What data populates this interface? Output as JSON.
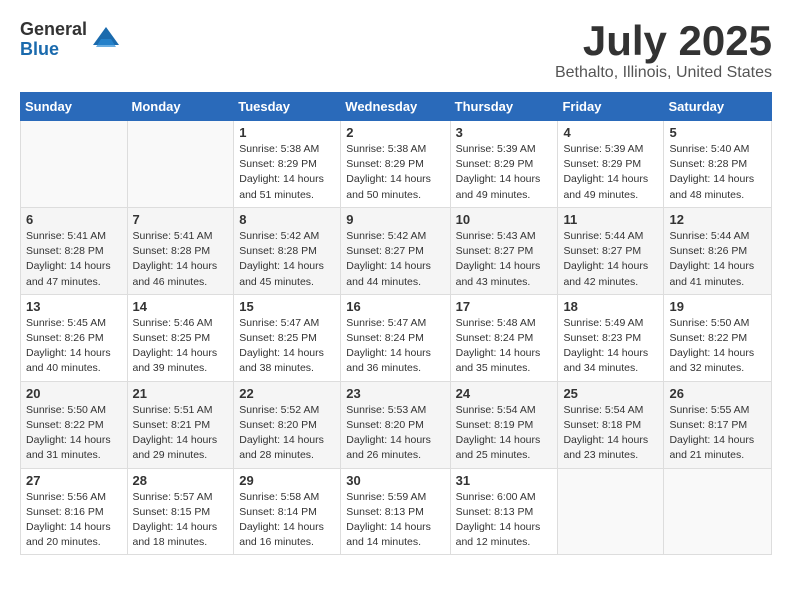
{
  "header": {
    "logo_general": "General",
    "logo_blue": "Blue",
    "month_title": "July 2025",
    "location": "Bethalto, Illinois, United States"
  },
  "weekdays": [
    "Sunday",
    "Monday",
    "Tuesday",
    "Wednesday",
    "Thursday",
    "Friday",
    "Saturday"
  ],
  "weeks": [
    [
      {
        "day": "",
        "info": ""
      },
      {
        "day": "",
        "info": ""
      },
      {
        "day": "1",
        "info": "Sunrise: 5:38 AM\nSunset: 8:29 PM\nDaylight: 14 hours and 51 minutes."
      },
      {
        "day": "2",
        "info": "Sunrise: 5:38 AM\nSunset: 8:29 PM\nDaylight: 14 hours and 50 minutes."
      },
      {
        "day": "3",
        "info": "Sunrise: 5:39 AM\nSunset: 8:29 PM\nDaylight: 14 hours and 49 minutes."
      },
      {
        "day": "4",
        "info": "Sunrise: 5:39 AM\nSunset: 8:29 PM\nDaylight: 14 hours and 49 minutes."
      },
      {
        "day": "5",
        "info": "Sunrise: 5:40 AM\nSunset: 8:28 PM\nDaylight: 14 hours and 48 minutes."
      }
    ],
    [
      {
        "day": "6",
        "info": "Sunrise: 5:41 AM\nSunset: 8:28 PM\nDaylight: 14 hours and 47 minutes."
      },
      {
        "day": "7",
        "info": "Sunrise: 5:41 AM\nSunset: 8:28 PM\nDaylight: 14 hours and 46 minutes."
      },
      {
        "day": "8",
        "info": "Sunrise: 5:42 AM\nSunset: 8:28 PM\nDaylight: 14 hours and 45 minutes."
      },
      {
        "day": "9",
        "info": "Sunrise: 5:42 AM\nSunset: 8:27 PM\nDaylight: 14 hours and 44 minutes."
      },
      {
        "day": "10",
        "info": "Sunrise: 5:43 AM\nSunset: 8:27 PM\nDaylight: 14 hours and 43 minutes."
      },
      {
        "day": "11",
        "info": "Sunrise: 5:44 AM\nSunset: 8:27 PM\nDaylight: 14 hours and 42 minutes."
      },
      {
        "day": "12",
        "info": "Sunrise: 5:44 AM\nSunset: 8:26 PM\nDaylight: 14 hours and 41 minutes."
      }
    ],
    [
      {
        "day": "13",
        "info": "Sunrise: 5:45 AM\nSunset: 8:26 PM\nDaylight: 14 hours and 40 minutes."
      },
      {
        "day": "14",
        "info": "Sunrise: 5:46 AM\nSunset: 8:25 PM\nDaylight: 14 hours and 39 minutes."
      },
      {
        "day": "15",
        "info": "Sunrise: 5:47 AM\nSunset: 8:25 PM\nDaylight: 14 hours and 38 minutes."
      },
      {
        "day": "16",
        "info": "Sunrise: 5:47 AM\nSunset: 8:24 PM\nDaylight: 14 hours and 36 minutes."
      },
      {
        "day": "17",
        "info": "Sunrise: 5:48 AM\nSunset: 8:24 PM\nDaylight: 14 hours and 35 minutes."
      },
      {
        "day": "18",
        "info": "Sunrise: 5:49 AM\nSunset: 8:23 PM\nDaylight: 14 hours and 34 minutes."
      },
      {
        "day": "19",
        "info": "Sunrise: 5:50 AM\nSunset: 8:22 PM\nDaylight: 14 hours and 32 minutes."
      }
    ],
    [
      {
        "day": "20",
        "info": "Sunrise: 5:50 AM\nSunset: 8:22 PM\nDaylight: 14 hours and 31 minutes."
      },
      {
        "day": "21",
        "info": "Sunrise: 5:51 AM\nSunset: 8:21 PM\nDaylight: 14 hours and 29 minutes."
      },
      {
        "day": "22",
        "info": "Sunrise: 5:52 AM\nSunset: 8:20 PM\nDaylight: 14 hours and 28 minutes."
      },
      {
        "day": "23",
        "info": "Sunrise: 5:53 AM\nSunset: 8:20 PM\nDaylight: 14 hours and 26 minutes."
      },
      {
        "day": "24",
        "info": "Sunrise: 5:54 AM\nSunset: 8:19 PM\nDaylight: 14 hours and 25 minutes."
      },
      {
        "day": "25",
        "info": "Sunrise: 5:54 AM\nSunset: 8:18 PM\nDaylight: 14 hours and 23 minutes."
      },
      {
        "day": "26",
        "info": "Sunrise: 5:55 AM\nSunset: 8:17 PM\nDaylight: 14 hours and 21 minutes."
      }
    ],
    [
      {
        "day": "27",
        "info": "Sunrise: 5:56 AM\nSunset: 8:16 PM\nDaylight: 14 hours and 20 minutes."
      },
      {
        "day": "28",
        "info": "Sunrise: 5:57 AM\nSunset: 8:15 PM\nDaylight: 14 hours and 18 minutes."
      },
      {
        "day": "29",
        "info": "Sunrise: 5:58 AM\nSunset: 8:14 PM\nDaylight: 14 hours and 16 minutes."
      },
      {
        "day": "30",
        "info": "Sunrise: 5:59 AM\nSunset: 8:13 PM\nDaylight: 14 hours and 14 minutes."
      },
      {
        "day": "31",
        "info": "Sunrise: 6:00 AM\nSunset: 8:13 PM\nDaylight: 14 hours and 12 minutes."
      },
      {
        "day": "",
        "info": ""
      },
      {
        "day": "",
        "info": ""
      }
    ]
  ]
}
